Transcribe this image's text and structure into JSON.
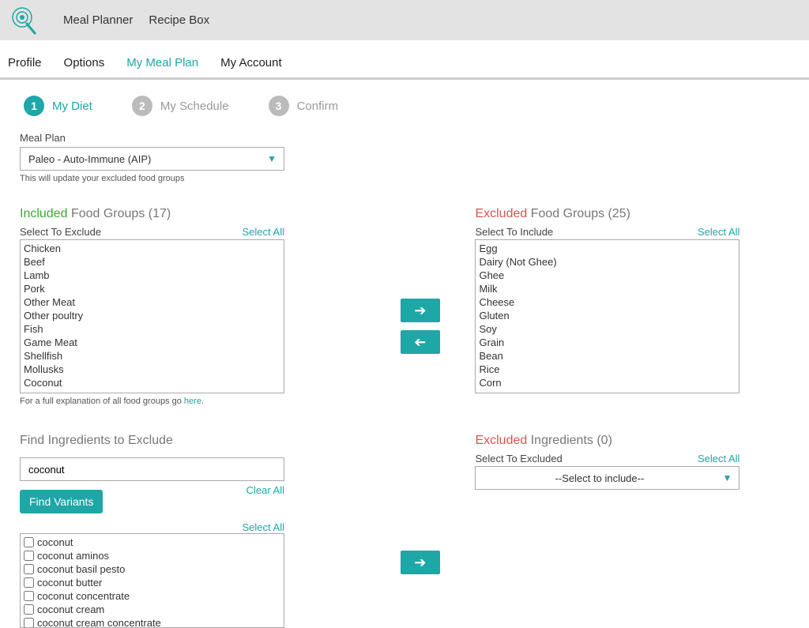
{
  "top_nav": {
    "meal_planner": "Meal Planner",
    "recipe_box": "Recipe Box"
  },
  "sub_nav": {
    "profile": "Profile",
    "options": "Options",
    "my_meal_plan": "My Meal Plan",
    "my_account": "My Account"
  },
  "wizard": {
    "step1_num": "1",
    "step1_label": "My Diet",
    "step2_num": "2",
    "step2_label": "My Schedule",
    "step3_num": "3",
    "step3_label": "Confirm"
  },
  "meal_plan": {
    "label": "Meal Plan",
    "value": "Paleo - Auto-Immune (AIP)",
    "help": "This will update your excluded food groups"
  },
  "included": {
    "title_green": "Included",
    "title_rest": " Food Groups (17)",
    "header": "Select To Exclude",
    "select_all": "Select All",
    "items": [
      "Chicken",
      "Beef",
      "Lamb",
      "Pork",
      "Other Meat",
      "Other poultry",
      "Fish",
      "Game Meat",
      "Shellfish",
      "Mollusks",
      "Coconut"
    ],
    "explain_prefix": "For a full explanation of all food groups go ",
    "explain_link": "here"
  },
  "excluded": {
    "title_red": "Excluded",
    "title_rest": " Food Groups (25)",
    "header": "Select To Include",
    "select_all": "Select All",
    "items": [
      "Egg",
      "Dairy (Not Ghee)",
      "Ghee",
      "Milk",
      "Cheese",
      "Gluten",
      "Soy",
      "Grain",
      "Bean",
      "Rice",
      "Corn"
    ]
  },
  "find": {
    "title": "Find Ingredients to Exclude",
    "value": "coconut",
    "clear_all": "Clear All",
    "find_variants": "Find Variants",
    "select_all": "Select All",
    "variants": [
      "coconut",
      "coconut aminos",
      "coconut basil pesto",
      "coconut butter",
      "coconut concentrate",
      "coconut cream",
      "coconut cream concentrate"
    ]
  },
  "excluded_ing": {
    "title_red": "Excluded",
    "title_rest": " Ingredients (0)",
    "header": "Select To Excluded",
    "select_all": "Select All",
    "placeholder": "--Select to include--"
  },
  "dot": "."
}
